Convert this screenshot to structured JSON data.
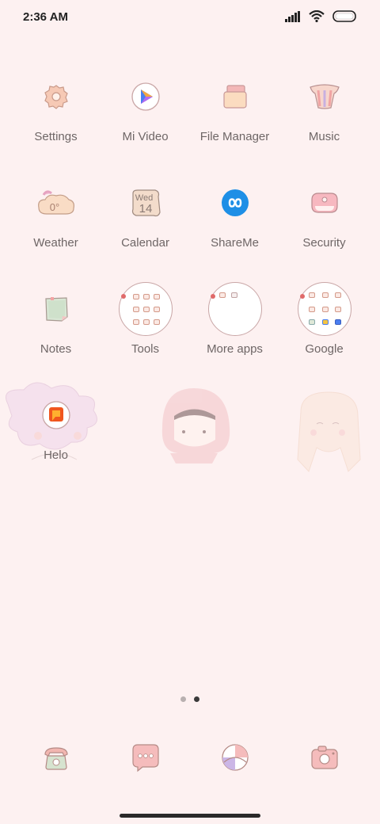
{
  "status_bar": {
    "time": "2:36 AM",
    "icons": [
      "signal-icon",
      "wifi-icon",
      "battery-icon"
    ]
  },
  "apps": [
    {
      "label": "Settings",
      "icon": "settings-icon"
    },
    {
      "label": "Mi Video",
      "icon": "mi-video-icon"
    },
    {
      "label": "File Manager",
      "icon": "file-manager-icon"
    },
    {
      "label": "Music",
      "icon": "music-icon"
    },
    {
      "label": "Weather",
      "icon": "weather-icon",
      "icon_text": "0°"
    },
    {
      "label": "Calendar",
      "icon": "calendar-icon",
      "icon_day": "Wed",
      "icon_date": "14"
    },
    {
      "label": "ShareMe",
      "icon": "shareme-icon"
    },
    {
      "label": "Security",
      "icon": "security-icon"
    },
    {
      "label": "Notes",
      "icon": "notes-icon"
    },
    {
      "label": "Tools",
      "icon": "tools-folder-icon"
    },
    {
      "label": "More apps",
      "icon": "more-apps-folder-icon"
    },
    {
      "label": "Google",
      "icon": "google-folder-icon"
    },
    {
      "label": "Helo",
      "icon": "helo-icon"
    }
  ],
  "page_indicator": {
    "pages": 2,
    "current": 2
  },
  "dock": [
    {
      "icon": "phone-icon"
    },
    {
      "icon": "messages-icon"
    },
    {
      "icon": "browser-icon"
    },
    {
      "icon": "camera-icon"
    }
  ],
  "colors": {
    "background": "#fdf1f1",
    "label": "#6e6666",
    "accent_pink": "#f2b6b6",
    "shareme_blue": "#1e8fe6"
  }
}
